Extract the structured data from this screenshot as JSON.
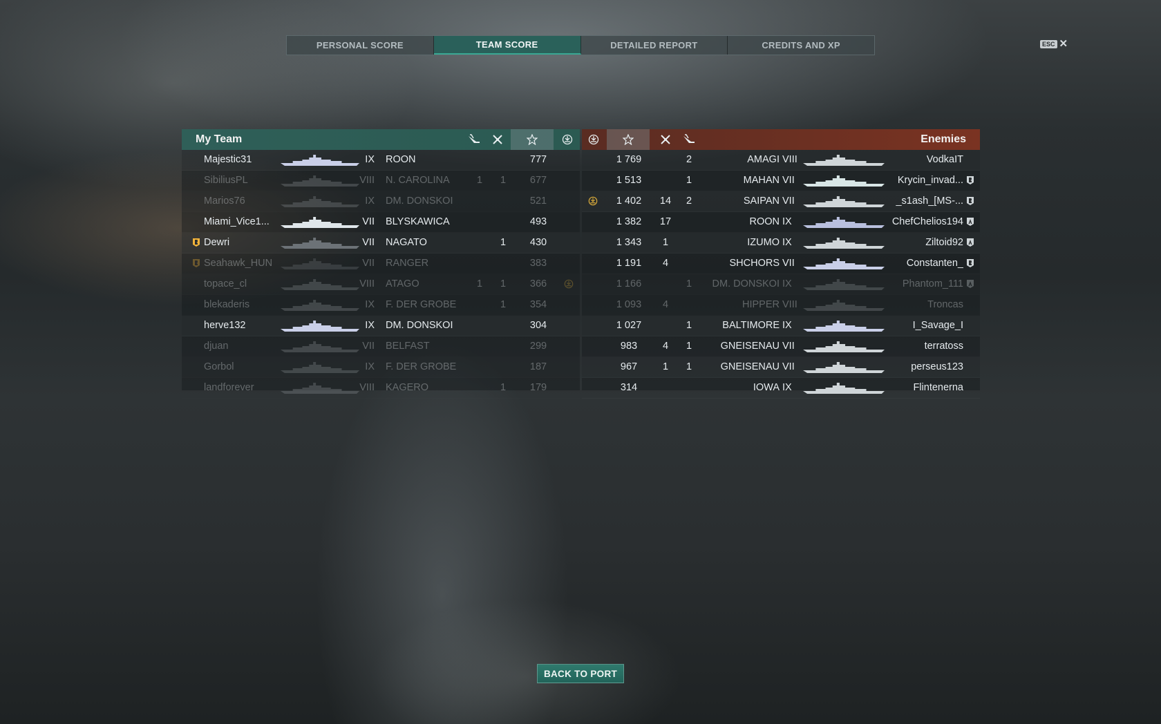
{
  "tabs": [
    "PERSONAL SCORE",
    "TEAM SCORE",
    "DETAILED REPORT",
    "CREDITS AND XP"
  ],
  "active_tab": 1,
  "esc_label": "ESC",
  "close_glyph": "✕",
  "my_team": {
    "title": "My Team",
    "header_icons": [
      "planes-shot-icon",
      "ships-destroyed-icon",
      "score-star-icon",
      "base-capture-icon"
    ],
    "rows": [
      {
        "name": "Majestic31",
        "tier": "IX",
        "ship": "ROON",
        "planes": "",
        "kills": "",
        "score": "777",
        "cap": false,
        "badge": "",
        "state": "pink",
        "silhouette_color": "#c9cfe8"
      },
      {
        "name": "SibiliusPL",
        "tier": "VIII",
        "ship": "N. CAROLINA",
        "planes": "1",
        "kills": "1",
        "score": "677",
        "cap": false,
        "badge": "",
        "state": "dead",
        "silhouette_color": "#8a9094"
      },
      {
        "name": "Marios76",
        "tier": "IX",
        "ship": "DM. DONSKOI",
        "planes": "",
        "kills": "",
        "score": "521",
        "cap": false,
        "badge": "",
        "state": "dead",
        "silhouette_color": "#8a9094"
      },
      {
        "name": "Miami_Vice1...",
        "tier": "VII",
        "ship": "BLYSKAWICA",
        "planes": "",
        "kills": "",
        "score": "493",
        "cap": false,
        "badge": "",
        "state": "alive",
        "silhouette_color": "#dfe6ea"
      },
      {
        "name": "Dewri",
        "tier": "VII",
        "ship": "NAGATO",
        "planes": "",
        "kills": "1",
        "score": "430",
        "cap": false,
        "badge": "division",
        "state": "self",
        "silhouette_color": "#6c7277"
      },
      {
        "name": "Seahawk_HUN",
        "tier": "VII",
        "ship": "RANGER",
        "planes": "",
        "kills": "",
        "score": "383",
        "cap": false,
        "badge": "division",
        "state": "dead-division",
        "silhouette_color": "#6c7277"
      },
      {
        "name": "topace_cl",
        "tier": "VIII",
        "ship": "ATAGO",
        "planes": "1",
        "kills": "1",
        "score": "366",
        "cap": true,
        "badge": "",
        "state": "dead",
        "silhouette_color": "#8a9094"
      },
      {
        "name": "blekaderis",
        "tier": "IX",
        "ship": "F. DER GROBE",
        "planes": "",
        "kills": "1",
        "score": "354",
        "cap": false,
        "badge": "",
        "state": "dead",
        "silhouette_color": "#8a9094"
      },
      {
        "name": "herve132",
        "tier": "IX",
        "ship": "DM. DONSKOI",
        "planes": "",
        "kills": "",
        "score": "304",
        "cap": false,
        "badge": "",
        "state": "alive",
        "silhouette_color": "#c9cfe8"
      },
      {
        "name": "djuan",
        "tier": "VII",
        "ship": "BELFAST",
        "planes": "",
        "kills": "",
        "score": "299",
        "cap": false,
        "badge": "",
        "state": "dead",
        "silhouette_color": "#8a9094"
      },
      {
        "name": "Gorbol",
        "tier": "IX",
        "ship": "F. DER GROBE",
        "planes": "",
        "kills": "",
        "score": "187",
        "cap": false,
        "badge": "",
        "state": "dead",
        "silhouette_color": "#8a9094"
      },
      {
        "name": "landforever",
        "tier": "VIII",
        "ship": "KAGERO",
        "planes": "",
        "kills": "1",
        "score": "179",
        "cap": false,
        "badge": "",
        "state": "dead",
        "silhouette_color": "#8a9094"
      }
    ]
  },
  "enemies": {
    "title": "Enemies",
    "header_icons": [
      "base-capture-icon",
      "score-star-icon",
      "ships-destroyed-icon",
      "planes-shot-icon"
    ],
    "rows": [
      {
        "name": "VodkaIT",
        "tier": "VIII",
        "ship": "AMAGI",
        "planes": "2",
        "kills": "",
        "score": "1 769",
        "cap": false,
        "badge": "",
        "state": "alive",
        "silhouette_color": "#cfd5d8"
      },
      {
        "name": "Krycin_invad...",
        "tier": "VII",
        "ship": "MAHAN",
        "planes": "1",
        "kills": "",
        "score": "1 513",
        "cap": false,
        "badge": "division",
        "state": "alive",
        "silhouette_color": "#d8e6e6"
      },
      {
        "name": "_s1ash_[MS-...",
        "tier": "VII",
        "ship": "SAIPAN",
        "planes": "2",
        "kills": "14",
        "score": "1 402",
        "cap": true,
        "badge": "division",
        "state": "alive",
        "silhouette_color": "#cfd5d8"
      },
      {
        "name": "ChefChelios194",
        "tier": "IX",
        "ship": "ROON",
        "planes": "",
        "kills": "17",
        "score": "1 382",
        "cap": false,
        "badge": "division-a",
        "state": "alive",
        "silhouette_color": "#b9c0de"
      },
      {
        "name": "Ziltoid92",
        "tier": "IX",
        "ship": "IZUMO",
        "planes": "",
        "kills": "1",
        "score": "1 343",
        "cap": false,
        "badge": "division-a",
        "state": "alive",
        "silhouette_color": "#cfd5d8"
      },
      {
        "name": "Constanten_",
        "tier": "VII",
        "ship": "SHCHORS",
        "planes": "",
        "kills": "4",
        "score": "1 191",
        "cap": false,
        "badge": "division",
        "state": "alive",
        "silhouette_color": "#c9cfe8"
      },
      {
        "name": "Phantom_111",
        "tier": "IX",
        "ship": "DM. DONSKOI",
        "planes": "1",
        "kills": "",
        "score": "1 166",
        "cap": false,
        "badge": "division-a",
        "state": "dead",
        "silhouette_color": "#8a9094"
      },
      {
        "name": "Troncas",
        "tier": "VIII",
        "ship": "HIPPER",
        "planes": "",
        "kills": "4",
        "score": "1 093",
        "cap": false,
        "badge": "",
        "state": "dead",
        "silhouette_color": "#8a9094"
      },
      {
        "name": "I_Savage_I",
        "tier": "IX",
        "ship": "BALTIMORE",
        "planes": "1",
        "kills": "",
        "score": "1 027",
        "cap": false,
        "badge": "",
        "state": "alive",
        "silhouette_color": "#c9cfe8"
      },
      {
        "name": "terratoss",
        "tier": "VII",
        "ship": "GNEISENAU",
        "planes": "1",
        "kills": "4",
        "score": "983",
        "cap": false,
        "badge": "",
        "state": "alive",
        "silhouette_color": "#cfd5d8"
      },
      {
        "name": "perseus123",
        "tier": "VII",
        "ship": "GNEISENAU",
        "planes": "1",
        "kills": "1",
        "score": "967",
        "cap": false,
        "badge": "",
        "state": "alive",
        "silhouette_color": "#cfd5d8"
      },
      {
        "name": "Flintenerna",
        "tier": "IX",
        "ship": "IOWA",
        "planes": "",
        "kills": "",
        "score": "314",
        "cap": false,
        "badge": "",
        "state": "alive",
        "silhouette_color": "#cfd5d8"
      }
    ]
  },
  "back_button": "BACK TO PORT",
  "colors": {
    "accent": "#2a6e63",
    "enemy": "#7a3322",
    "self": "#f2b33a",
    "division": "#f2b33a",
    "pink": "#d76fb2"
  }
}
